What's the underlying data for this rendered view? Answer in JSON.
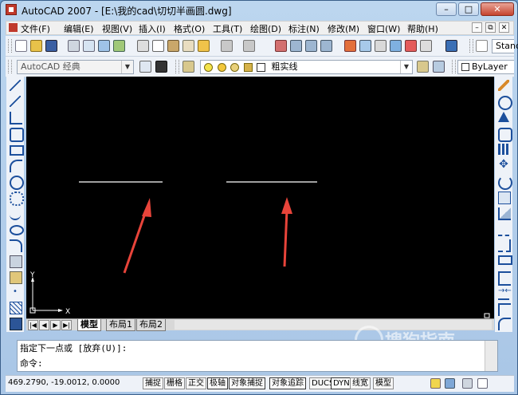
{
  "titlebar": {
    "title": "AutoCAD 2007 - [E:\\我的cad\\切切半画圆.dwg]",
    "min": "–",
    "max": "□",
    "close": "✕"
  },
  "menu": {
    "items": [
      "文件(F)",
      "编辑(E)",
      "视图(V)",
      "插入(I)",
      "格式(O)",
      "工具(T)",
      "绘图(D)",
      "标注(N)",
      "修改(M)",
      "窗口(W)",
      "帮助(H)"
    ],
    "mdi": [
      "–",
      "⧉",
      "✕"
    ]
  },
  "toolbar2": {
    "workspace": "AutoCAD 经典",
    "layer": "粗实线",
    "color": "ByLayer",
    "style_partial": "Stand"
  },
  "canvas": {
    "ucs_y": "Y",
    "ucs_x": "X",
    "watermark_main": "搜狗指南",
    "watermark_url": "zhinan.sogou.com"
  },
  "tabs": {
    "items": [
      "模型",
      "布局1",
      "布局2"
    ]
  },
  "command": {
    "line1": "指定下一点或 [放弃(U)]:",
    "line2": "命令:"
  },
  "status": {
    "coords": "469.2790, -19.0012, 0.0000",
    "buttons": [
      "捕捉",
      "栅格",
      "正交",
      "极轴",
      "对象捕捉",
      "对象追踪",
      "DUCS",
      "DYN",
      "线宽",
      "模型"
    ]
  },
  "colors": {
    "canvas_bg": "#000000",
    "line": "#ffffff",
    "arrow": "#e8443a"
  }
}
